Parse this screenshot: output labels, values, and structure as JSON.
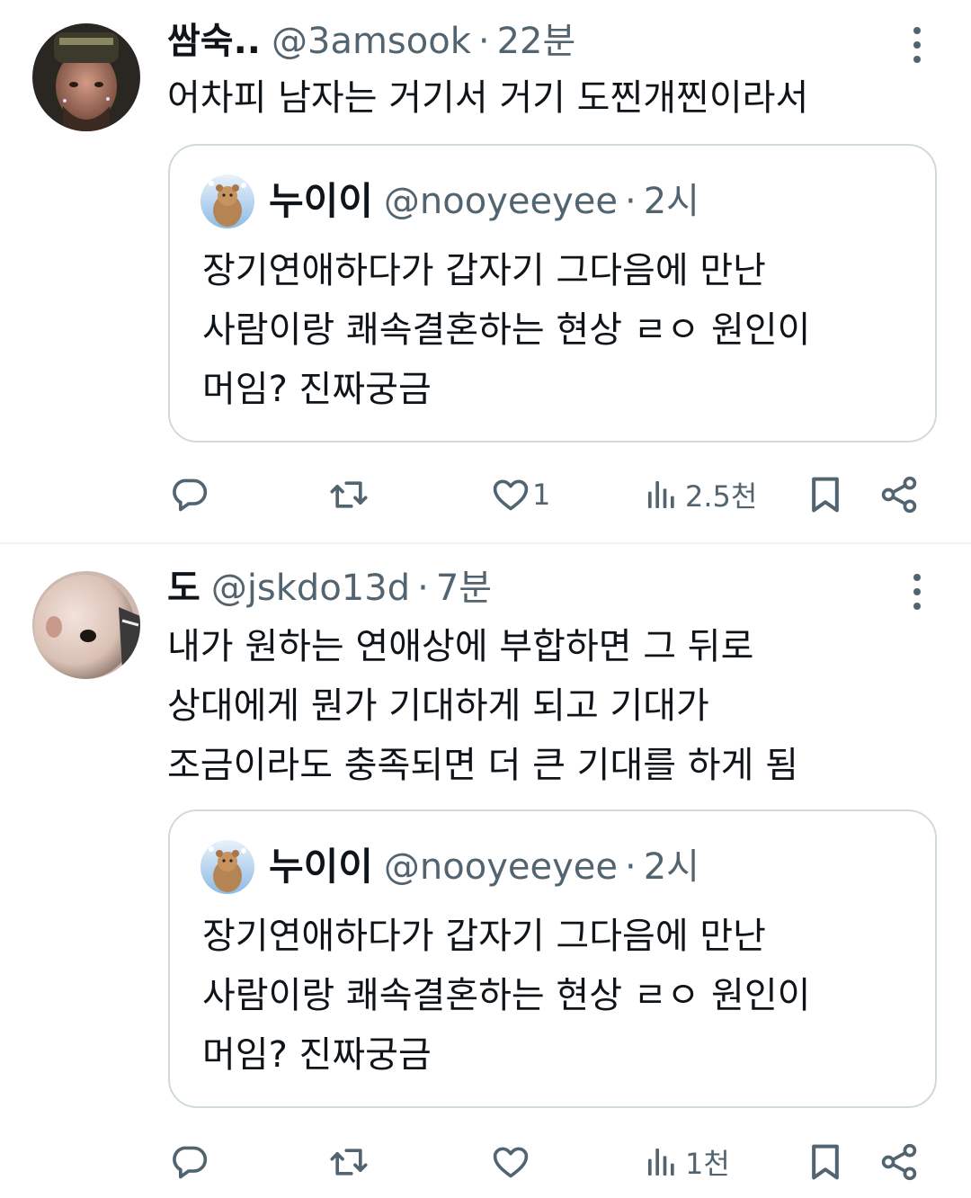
{
  "tweets": [
    {
      "name": "쌈숙..",
      "handle": "@3amsook",
      "separator": "·",
      "time": "22분",
      "text": "어차피 남자는 거기서 거기 도찐개찐이라서",
      "quote": {
        "name": "누이이",
        "handle": "@nooyeeyee",
        "separator": "·",
        "time": "2시",
        "lines": [
          "장기연애하다가 갑자기 그다음에 만난",
          "사람이랑 쾌속결혼하는 현상 ㄹㅇ 원인이",
          "머임? 진짜궁금"
        ]
      },
      "actions": {
        "reply_count": "",
        "retweet_count": "",
        "like_count": "1",
        "views": "2.5천"
      }
    },
    {
      "name": "도",
      "handle": "@jskdo13d",
      "separator": "·",
      "time": "7분",
      "lines": [
        "내가 원하는 연애상에 부합하면 그 뒤로",
        "상대에게 뭔가 기대하게 되고 기대가",
        "조금이라도 충족되면 더 큰 기대를 하게 됨"
      ],
      "quote": {
        "name": "누이이",
        "handle": "@nooyeeyee",
        "separator": "·",
        "time": "2시",
        "lines": [
          "장기연애하다가 갑자기 그다음에 만난",
          "사람이랑 쾌속결혼하는 현상 ㄹㅇ 원인이",
          "머임? 진짜궁금"
        ]
      },
      "actions": {
        "reply_count": "",
        "retweet_count": "",
        "like_count": "",
        "views": "1천"
      }
    }
  ],
  "icons": {
    "reply": "reply-icon",
    "retweet": "retweet-icon",
    "like": "heart-icon",
    "views": "views-icon",
    "bookmark": "bookmark-icon",
    "share": "share-icon",
    "more": "more-icon"
  },
  "colors": {
    "text": "#0f1419",
    "secondary": "#536471",
    "border": "#cfd9de",
    "divider": "#eff3f4"
  }
}
